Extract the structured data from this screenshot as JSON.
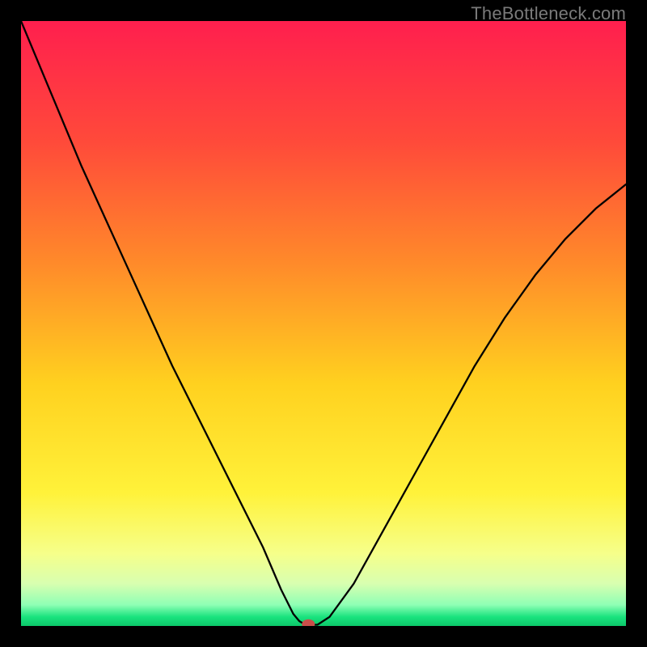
{
  "watermark": "TheBottleneck.com",
  "chart_data": {
    "type": "line",
    "title": "",
    "xlabel": "",
    "ylabel": "",
    "xlim": [
      0,
      100
    ],
    "ylim": [
      0,
      100
    ],
    "grid": false,
    "series": [
      {
        "name": "curve",
        "x": [
          0,
          5,
          10,
          15,
          20,
          25,
          30,
          35,
          40,
          43,
          45,
          46,
          47,
          48,
          49,
          51,
          55,
          60,
          65,
          70,
          75,
          80,
          85,
          90,
          95,
          100
        ],
        "y": [
          100,
          88,
          76,
          65,
          54,
          43,
          33,
          23,
          13,
          6,
          2,
          0.8,
          0.2,
          0.2,
          0.2,
          1.5,
          7,
          16,
          25,
          34,
          43,
          51,
          58,
          64,
          69,
          73
        ]
      }
    ],
    "background_gradient": {
      "stops": [
        {
          "offset": 0.0,
          "color": "#ff1f4e"
        },
        {
          "offset": 0.2,
          "color": "#ff4a3a"
        },
        {
          "offset": 0.4,
          "color": "#ff8a2a"
        },
        {
          "offset": 0.6,
          "color": "#ffd11f"
        },
        {
          "offset": 0.78,
          "color": "#fff23a"
        },
        {
          "offset": 0.88,
          "color": "#f6ff8a"
        },
        {
          "offset": 0.93,
          "color": "#d8ffb0"
        },
        {
          "offset": 0.965,
          "color": "#8fffb5"
        },
        {
          "offset": 0.985,
          "color": "#19e37e"
        },
        {
          "offset": 1.0,
          "color": "#0cc86a"
        }
      ]
    },
    "marker": {
      "x": 47.5,
      "y": 0.3,
      "color": "#c94f4a"
    },
    "curve_color": "#000000",
    "curve_width": 2.3
  }
}
